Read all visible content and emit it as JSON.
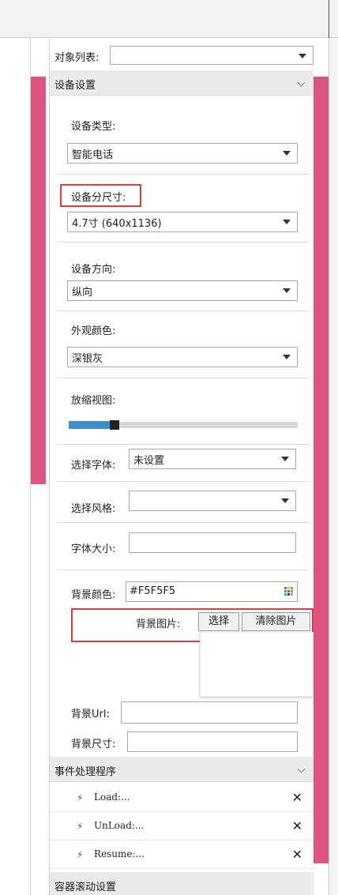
{
  "object_list": {
    "label": "对象列表:",
    "value": ""
  },
  "device_settings": {
    "header": "设备设置",
    "device_type": {
      "label": "设备类型:",
      "value": "智能电话"
    },
    "device_size": {
      "label": "设备分尺寸:",
      "value": "4.7寸 (640x1136)"
    },
    "orientation": {
      "label": "设备方向:",
      "value": "纵向"
    },
    "appearance_color": {
      "label": "外观颜色:",
      "value": "深银灰"
    },
    "zoom_view": {
      "label": "放缩视图:",
      "level": 0.18
    },
    "font": {
      "label": "选择字体:",
      "value": "未设置"
    },
    "style": {
      "label": "选择风格:",
      "value": ""
    },
    "font_size": {
      "label": "字体大小:",
      "value": ""
    },
    "bg_color": {
      "label": "背景颜色:",
      "value": "#F5F5F5"
    },
    "bg_image": {
      "label": "背景图片:",
      "choose_button": "选择",
      "clear_button": "清除图片"
    },
    "bg_url": {
      "label": "背景Url:",
      "value": ""
    },
    "bg_size": {
      "label": "背景尺寸:",
      "value": ""
    }
  },
  "events": {
    "header": "事件处理程序",
    "items": [
      {
        "name": "Load:..."
      },
      {
        "name": "UnLoad:..."
      },
      {
        "name": "Resume:..."
      }
    ]
  },
  "container_scroll": {
    "header": "容器滚动设置"
  },
  "colors": {
    "accent_pink": "#dd5682",
    "highlight_red": "#e23b3b",
    "zoom_blue": "#3a8fd3"
  }
}
